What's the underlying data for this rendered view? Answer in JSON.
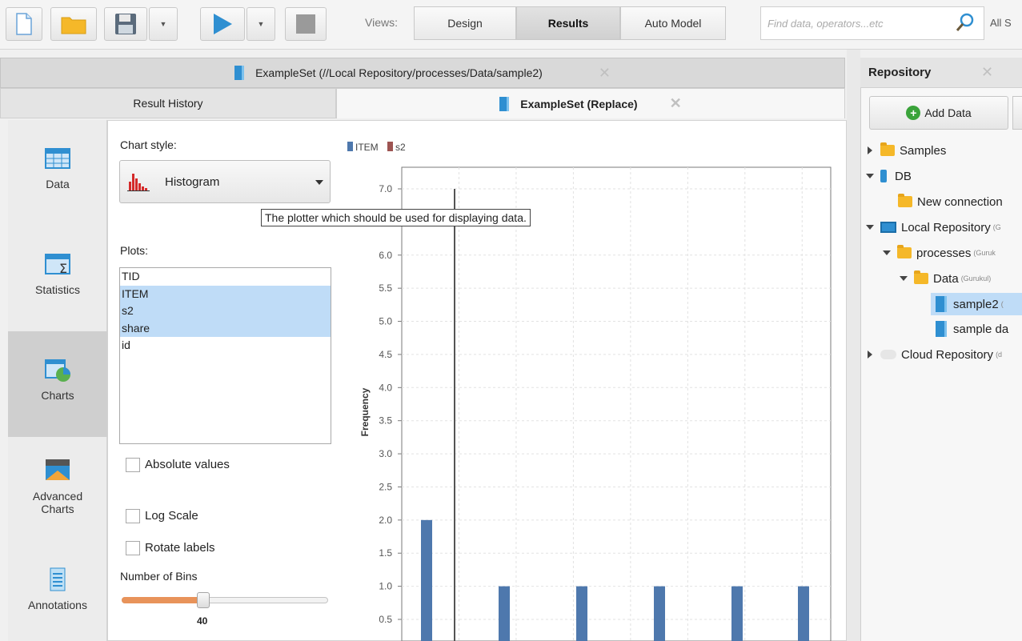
{
  "toolbar": {
    "views_label": "Views:",
    "view_tabs": [
      "Design",
      "Results",
      "Auto Model"
    ],
    "active_view": "Results",
    "search_placeholder": "Find data, operators...etc",
    "all_label": "All S"
  },
  "result_tabs": {
    "top_tab": "ExampleSet (//Local Repository/processes/Data/sample2)",
    "result_history": "Result History",
    "active_tab": "ExampleSet (Replace)"
  },
  "leftnav": {
    "items": [
      {
        "label": "Data",
        "icon": "table-icon"
      },
      {
        "label": "Statistics",
        "icon": "sigma-table-icon"
      },
      {
        "label": "Charts",
        "icon": "pie-table-icon"
      },
      {
        "label": "Advanced\nCharts",
        "label_l1": "Advanced",
        "label_l2": "Charts",
        "icon": "advanced-charts-icon"
      },
      {
        "label": "Annotations",
        "icon": "notepad-icon"
      }
    ],
    "active": "Charts"
  },
  "chart_panel": {
    "chart_style_label": "Chart style:",
    "chart_style_value": "Histogram",
    "tooltip": "The plotter which should be used for displaying data.",
    "plots_label": "Plots:",
    "plots": [
      {
        "name": "TID",
        "selected": false
      },
      {
        "name": "ITEM",
        "selected": true
      },
      {
        "name": "s2",
        "selected": true
      },
      {
        "name": "share",
        "selected": true
      },
      {
        "name": "id",
        "selected": false
      }
    ],
    "absolute_values": "Absolute values",
    "log_scale": "Log Scale",
    "rotate_labels": "Rotate labels",
    "bins_label": "Number of Bins",
    "bins_value": "40",
    "bins_fraction": 0.38
  },
  "chart_data": {
    "type": "bar",
    "ylabel": "Frequency",
    "ylim": [
      0.5,
      7.0
    ],
    "yticks": [
      "0.5",
      "1.0",
      "1.5",
      "2.0",
      "2.5",
      "3.0",
      "3.5",
      "4.0",
      "4.5",
      "5.0",
      "5.5",
      "6.0",
      "7.0"
    ],
    "legend": [
      "ITEM",
      "s2"
    ],
    "colors": {
      "ITEM": "#4e78ad",
      "s2": "#9d5452"
    },
    "series": [
      {
        "name": "ITEM",
        "values": [
          2.0,
          1.0,
          1.0,
          1.0,
          1.0,
          1.0
        ]
      },
      {
        "name": "s2",
        "values": [
          7.0
        ]
      }
    ]
  },
  "repository": {
    "title": "Repository",
    "add_data": "Add Data",
    "tree": [
      {
        "label": "Samples",
        "sub": ""
      },
      {
        "label": "DB",
        "sub": ""
      },
      {
        "label": "New connection",
        "sub": ""
      },
      {
        "label": "Local Repository",
        "sub": "(G"
      },
      {
        "label": "processes",
        "sub": "(Guruk"
      },
      {
        "label": "Data",
        "sub": "(Gurukul)"
      },
      {
        "label": "sample2",
        "sub": "("
      },
      {
        "label": "sample da",
        "sub": ""
      },
      {
        "label": "Cloud Repository",
        "sub": "(d"
      }
    ]
  }
}
